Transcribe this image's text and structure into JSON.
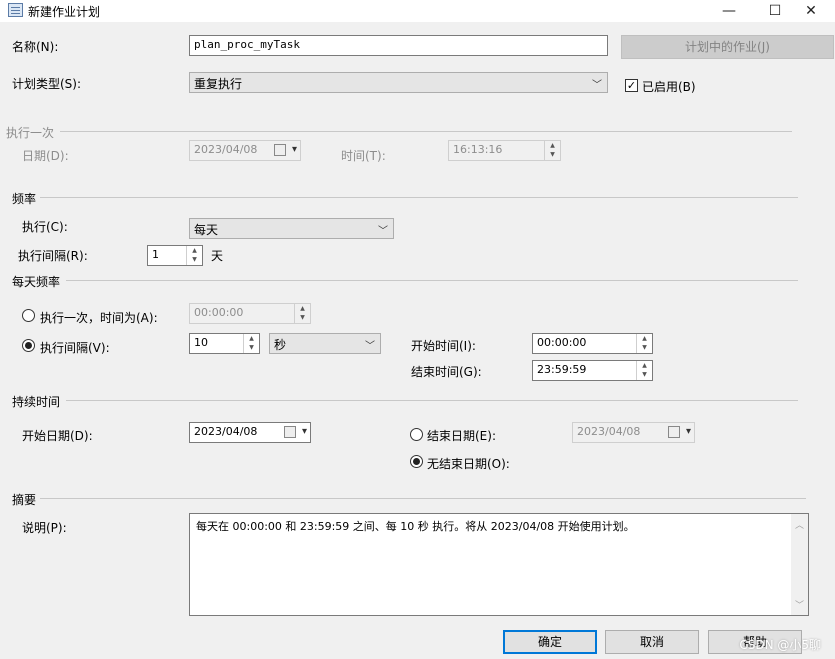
{
  "window": {
    "title": "新建作业计划",
    "minimize": "—",
    "maximize": "☐",
    "close": "✕"
  },
  "name_row": {
    "label": "名称(N):",
    "value": "plan_proc_myTask",
    "jobs_button": "计划中的作业(J)"
  },
  "schedule_type": {
    "label": "计划类型(S):",
    "value": "重复执行",
    "enabled_label": "已启用(B)",
    "enabled": true
  },
  "one_time": {
    "group_label": "执行一次",
    "date_label": "日期(D):",
    "date_value": "2023/04/08",
    "time_label": "时间(T):",
    "time_value": "16:13:16"
  },
  "frequency": {
    "group_label": "频率",
    "occurs_label": "执行(C):",
    "occurs_value": "每天",
    "recurs_label": "执行间隔(R):",
    "recurs_value": "1",
    "recurs_unit": "天"
  },
  "daily_frequency": {
    "group_label": "每天频率",
    "once_label": "执行一次，时间为(A):",
    "once_value": "00:00:00",
    "every_label": "执行间隔(V):",
    "every_value": "10",
    "every_unit": "秒",
    "start_time_label": "开始时间(I):",
    "start_time_value": "00:00:00",
    "end_time_label": "结束时间(G):",
    "end_time_value": "23:59:59"
  },
  "duration": {
    "group_label": "持续时间",
    "start_date_label": "开始日期(D):",
    "start_date_value": "2023/04/08",
    "end_date_label": "结束日期(E):",
    "end_date_value": "2023/04/08",
    "no_end_label": "无结束日期(O):"
  },
  "summary": {
    "group_label": "摘要",
    "description_label": "说明(P):",
    "description_value": "每天在 00:00:00 和 23:59:59 之间、每 10 秒 执行。将从 2023/04/08 开始使用计划。"
  },
  "footer": {
    "ok": "确定",
    "cancel": "取消",
    "help": "帮助"
  },
  "watermark": "CSDN @小5聊"
}
